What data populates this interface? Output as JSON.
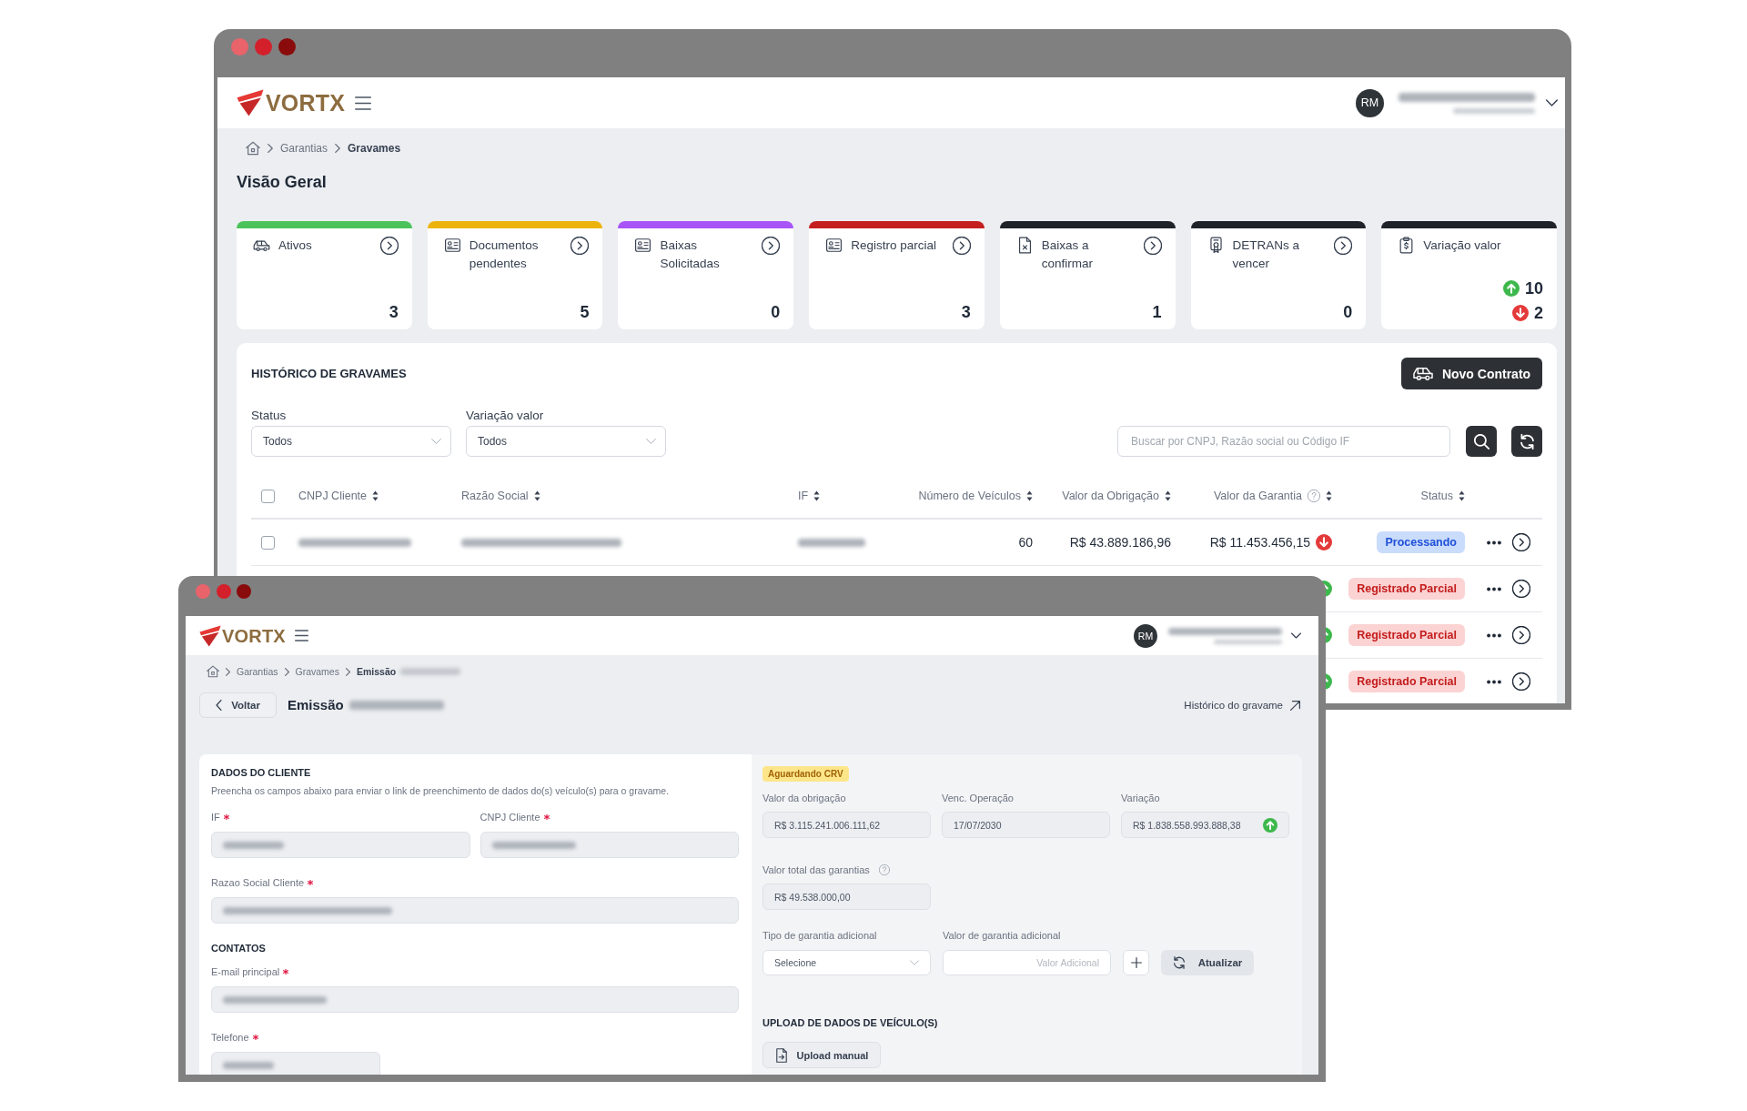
{
  "windows": [
    {
      "kind": "dashboard",
      "header": {
        "logo_text": "VORTX",
        "avatar_initials": "RM",
        "user_redacted": true
      },
      "breadcrumb": [
        {
          "label": "Garantias",
          "current": false,
          "redacted_suffix": false
        },
        {
          "label": "Gravames",
          "current": true,
          "redacted_suffix": false
        }
      ],
      "page_title": "Visão Geral",
      "summary_cards": [
        {
          "kind": "count",
          "title": "Ativos",
          "count": "3",
          "color": "#4cc25a"
        },
        {
          "kind": "count",
          "title": "Documentos pendentes",
          "count": "5",
          "color": "#ebb30c"
        },
        {
          "kind": "count",
          "title": "Baixas Solicitadas",
          "count": "0",
          "color": "#a855f7"
        },
        {
          "kind": "count",
          "title": "Registro parcial",
          "count": "3",
          "color": "#c41e1e"
        },
        {
          "kind": "count",
          "title": "Baixas a confirmar",
          "count": "1",
          "color": "#1f2329"
        },
        {
          "kind": "count",
          "title": "DETRANs a vencer",
          "count": "0",
          "color": "#1f2329"
        },
        {
          "kind": "variation",
          "title": "Variação valor",
          "up_count": "10",
          "down_count": "2",
          "color": "#1f2329"
        }
      ],
      "history": {
        "title": "HISTÓRICO DE GRAVAMES",
        "new_button": "Novo Contrato",
        "filters": [
          {
            "label": "Status",
            "value": "Todos"
          },
          {
            "label": "Variação valor",
            "value": "Todos"
          }
        ],
        "search": {
          "placeholder": "Buscar por CNPJ, Razão social ou Código IF"
        },
        "table": {
          "select_all_checked": false,
          "columns": [
            {
              "label": "CNPJ Cliente",
              "help": false
            },
            {
              "label": "Razão Social",
              "help": false
            },
            {
              "label": "IF",
              "help": false
            },
            {
              "label": "Número de Veículos",
              "help": false
            },
            {
              "label": "Valor da Obrigação",
              "help": false
            },
            {
              "label": "Valor da Garantia",
              "help": true
            },
            {
              "label": "Status",
              "help": false
            }
          ],
          "rows": [
            {
              "checked": false,
              "redacted": true,
              "vehicles": "60",
              "obligation": "R$ 43.889.186,96",
              "guarantee": "R$ 11.453.456,15",
              "rising": false,
              "falling": true,
              "status": {
                "kind": "processing",
                "label": "Processando"
              }
            },
            {
              "rising": true,
              "falling": false,
              "status": {
                "kind": "partial",
                "label": "Registrado Parcial"
              }
            },
            {
              "rising": true,
              "falling": false,
              "status": {
                "kind": "partial",
                "label": "Registrado Parcial"
              }
            },
            {
              "rising": true,
              "falling": false,
              "status": {
                "kind": "partial",
                "label": "Registrado Parcial"
              }
            }
          ]
        }
      }
    },
    {
      "kind": "emission",
      "header": {
        "logo_text": "VORTX",
        "avatar_initials": "RM",
        "user_redacted": true
      },
      "breadcrumb": [
        {
          "label": "Garantias",
          "current": false,
          "redacted_suffix": false
        },
        {
          "label": "Gravames",
          "current": false,
          "redacted_suffix": false
        },
        {
          "label": "Emissão",
          "current": true,
          "redacted_suffix": true
        }
      ],
      "back_button": "Voltar",
      "page_title": "Emissão",
      "page_title_redacted": true,
      "history_link": "Histórico do gravame",
      "client_section": {
        "title": "DADOS DO CLIENTE",
        "description": "Preencha os campos abaixo para enviar o link de preenchimento de dados do(s) veículo(s) para o gravame.",
        "field_rows": [
          [
            {
              "kind": "text",
              "label": "IF",
              "required": true,
              "redacted": true
            },
            {
              "kind": "text",
              "label": "CNPJ Cliente",
              "required": true,
              "redacted": true
            }
          ],
          [
            {
              "kind": "text",
              "label": "Razao Social Cliente",
              "required": true,
              "redacted": true
            }
          ]
        ]
      },
      "contacts_section": {
        "title": "CONTATOS",
        "field_rows": [
          [
            {
              "kind": "text",
              "label": "E-mail principal",
              "required": true,
              "redacted": true
            }
          ],
          [
            {
              "kind": "phone",
              "label": "Telefone",
              "required": true,
              "redacted": true
            }
          ]
        ]
      },
      "guarantee_panel": {
        "status_badge": "Aguardando CRV",
        "amounts": [
          {
            "label": "Valor da obrigação",
            "value": "R$ 3.115.241.006.111,62",
            "rising": false,
            "falling": false
          },
          {
            "label": "Venc. Operação",
            "value": "17/07/2030",
            "rising": false,
            "falling": false
          },
          {
            "label": "Variação",
            "value": "R$ 1.838.558.993.888,38",
            "rising": true,
            "falling": false
          }
        ],
        "total": {
          "label": "Valor total das garantias",
          "value": "R$ 49.538.000,00",
          "help": true
        },
        "additional": {
          "type_label": "Tipo de garantia adicional",
          "type_value": "Selecione",
          "value_label": "Valor de garantia adicional",
          "value_placeholder": "Valor Adicional",
          "update_button": "Atualizar"
        },
        "upload": {
          "title": "UPLOAD DE DADOS DE VEÍCULO(S)",
          "button": "Upload manual"
        }
      }
    }
  ]
}
